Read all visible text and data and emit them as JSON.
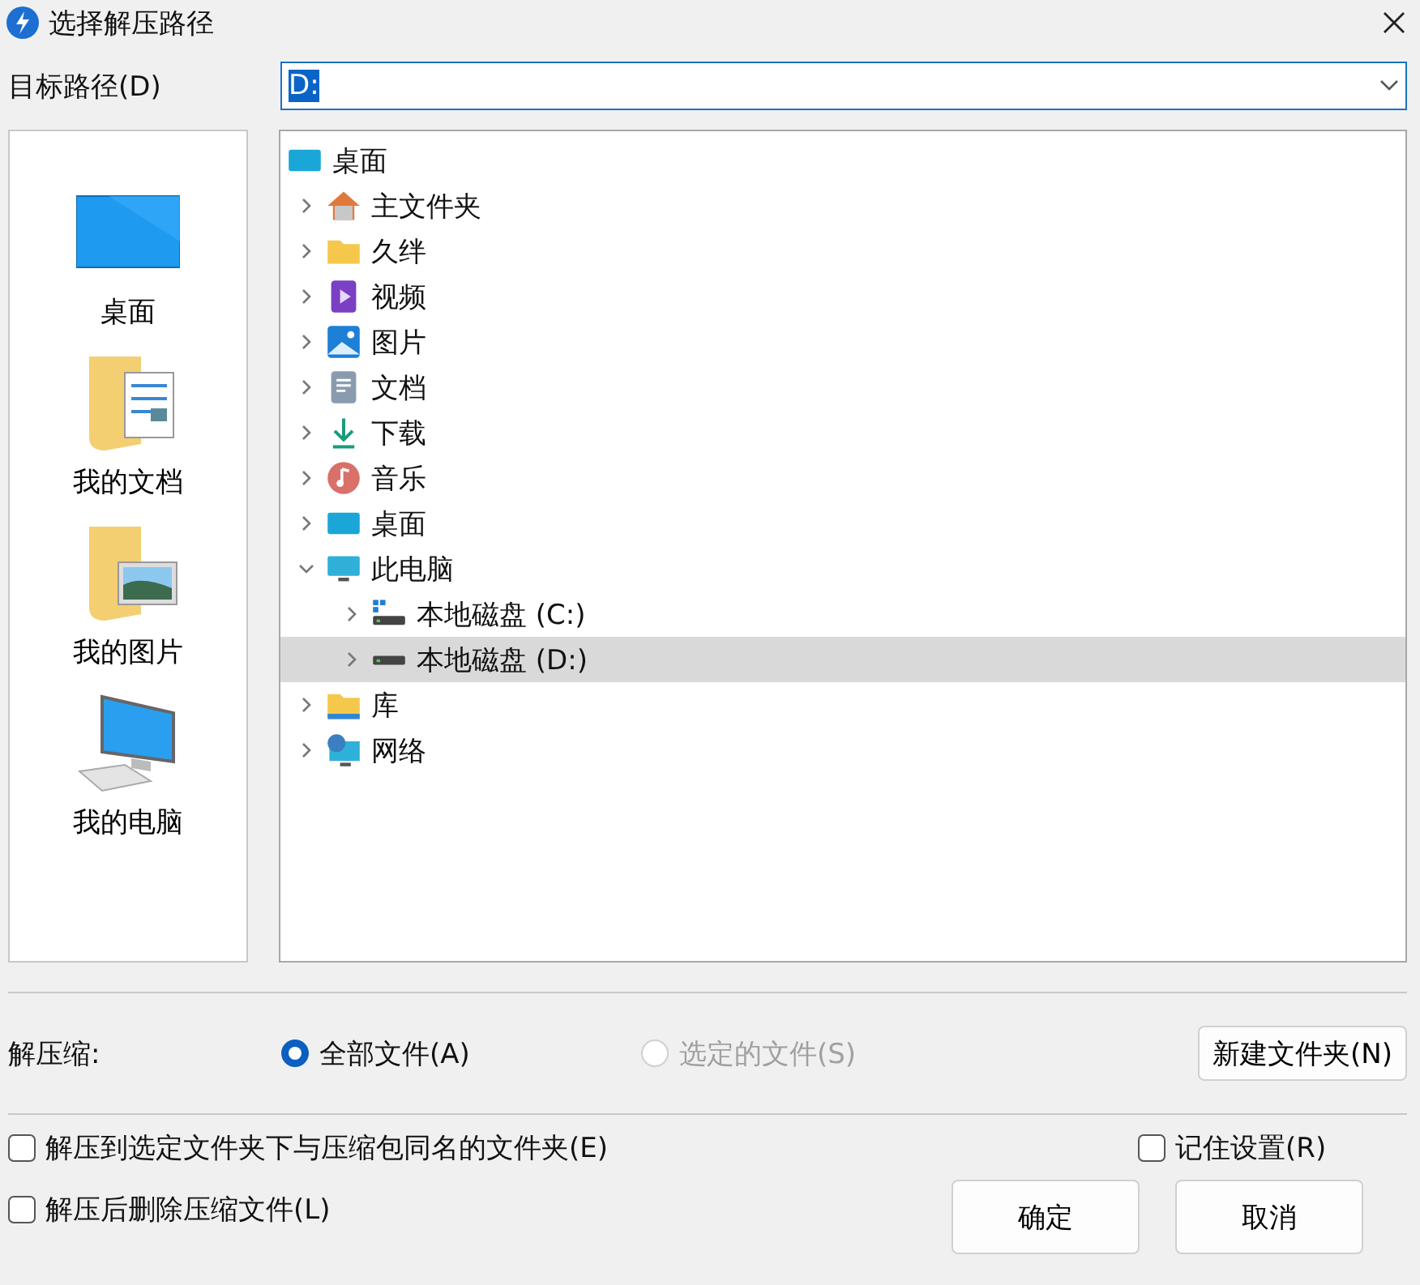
{
  "window": {
    "title": "选择解压路径"
  },
  "path": {
    "label": "目标路径(D)",
    "value": "D:"
  },
  "places": [
    {
      "label": "桌面",
      "kind": "desktop"
    },
    {
      "label": "我的文档",
      "kind": "documents"
    },
    {
      "label": "我的图片",
      "kind": "pictures"
    },
    {
      "label": "我的电脑",
      "kind": "computer"
    }
  ],
  "tree": {
    "label": "桌面",
    "kind": "desktop",
    "children": [
      {
        "label": "主文件夹",
        "kind": "home",
        "expanded": false,
        "selected": false
      },
      {
        "label": "久绊",
        "kind": "folder",
        "expanded": false,
        "selected": false
      },
      {
        "label": "视频",
        "kind": "video",
        "expanded": false,
        "selected": false
      },
      {
        "label": "图片",
        "kind": "pictures",
        "expanded": false,
        "selected": false
      },
      {
        "label": "文档",
        "kind": "documents",
        "expanded": false,
        "selected": false
      },
      {
        "label": "下载",
        "kind": "downloads",
        "expanded": false,
        "selected": false
      },
      {
        "label": "音乐",
        "kind": "music",
        "expanded": false,
        "selected": false
      },
      {
        "label": "桌面",
        "kind": "desktop",
        "expanded": false,
        "selected": false
      },
      {
        "label": "此电脑",
        "kind": "computer",
        "expanded": true,
        "selected": false,
        "children": [
          {
            "label": "本地磁盘 (C:)",
            "kind": "system",
            "expanded": false,
            "selected": false
          },
          {
            "label": "本地磁盘 (D:)",
            "kind": "drive",
            "expanded": false,
            "selected": true
          }
        ]
      },
      {
        "label": "库",
        "kind": "library",
        "expanded": false,
        "selected": false
      },
      {
        "label": "网络",
        "kind": "network",
        "expanded": false,
        "selected": false
      }
    ]
  },
  "extract": {
    "label": "解压缩:",
    "options": [
      {
        "label": "全部文件(A)",
        "selected": true,
        "disabled": false
      },
      {
        "label": "选定的文件(S)",
        "selected": false,
        "disabled": true
      }
    ],
    "new_folder_button": "新建文件夹(N)"
  },
  "checkboxes": [
    {
      "label": "解压到选定文件夹下与压缩包同名的文件夹(E)",
      "checked": false
    },
    {
      "label": "记住设置(R)",
      "checked": false
    },
    {
      "label": "解压后删除压缩文件(L)",
      "checked": false
    }
  ],
  "buttons": [
    "确定",
    "取消"
  ]
}
